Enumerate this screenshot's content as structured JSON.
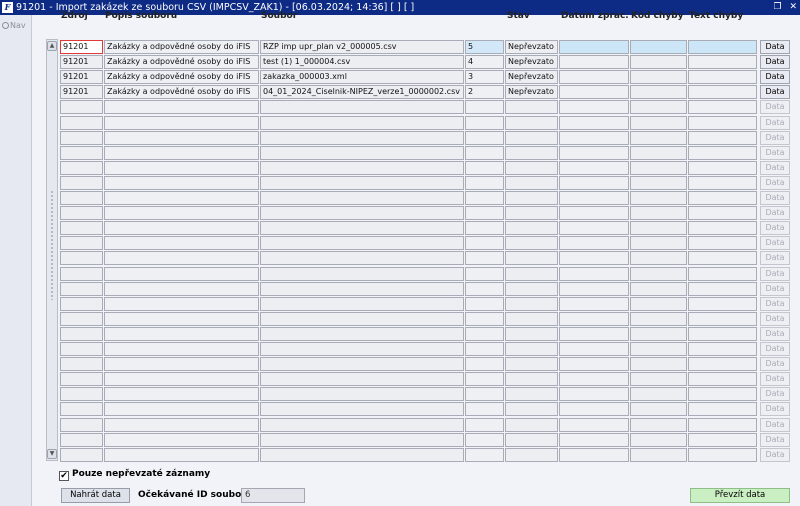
{
  "window": {
    "title": "91201 - Import zakázek ze souboru CSV (IMPCSV_ZAK1) - [06.03.2024; 14:36] [ ] [ ]",
    "app_icon": "F",
    "restore_glyph": "❐",
    "close_glyph": "✕"
  },
  "nav": {
    "label": "Nav",
    "icon": "nav-icon"
  },
  "columns": [
    "Zdroj",
    "Popis souboru",
    "Soubor",
    "Stav",
    "Datum zprac.",
    "Kód chyby",
    "Text chyby"
  ],
  "rows": [
    {
      "zdroj": "91201",
      "popis": "Zakázky a odpovědné osoby do iFIS",
      "soubor": "RZP imp upr_plan v2_000005.csv",
      "pocet": "5",
      "stav": "Nepřevzato",
      "datum": "",
      "kod": "",
      "text": "",
      "button": "Data"
    },
    {
      "zdroj": "91201",
      "popis": "Zakázky a odpovědné osoby do iFIS",
      "soubor": "test (1) 1_000004.csv",
      "pocet": "4",
      "stav": "Nepřevzato",
      "datum": "",
      "kod": "",
      "text": "",
      "button": "Data"
    },
    {
      "zdroj": "91201",
      "popis": "Zakázky a odpovědné osoby do iFIS",
      "soubor": "zakazka_000003.xml",
      "pocet": "3",
      "stav": "Nepřevzato",
      "datum": "",
      "kod": "",
      "text": "",
      "button": "Data"
    },
    {
      "zdroj": "91201",
      "popis": "Zakázky a odpovědné osoby do iFIS",
      "soubor": "04_01_2024_Ciselnik-NIPEZ_verze1_0000002.csv",
      "pocet": "2",
      "stav": "Nepřevzato",
      "datum": "",
      "kod": "",
      "text": "",
      "button": "Data"
    }
  ],
  "empty_row_button": "Data",
  "footer": {
    "checkbox_label": "Pouze nepřevzaté záznamy",
    "checkbox_checked": "✔",
    "load_button": "Nahrát data",
    "expected_label": "Očekávané ID souboru",
    "expected_value": "6",
    "take_button": "Převzít data"
  },
  "colors": {
    "titlebar": "#0d2a84",
    "selected_row": "#d2e8f8",
    "take_button": "#c9efc3"
  }
}
